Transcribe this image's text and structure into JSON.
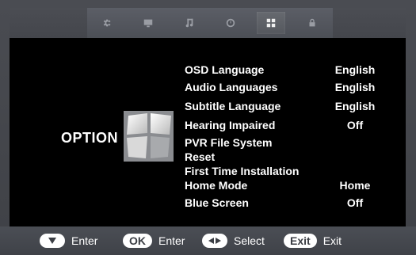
{
  "tabs": [
    {
      "icon": "gear-icon",
      "active": false
    },
    {
      "icon": "monitor-icon",
      "active": false
    },
    {
      "icon": "music-note-icon",
      "active": false
    },
    {
      "icon": "clock-icon",
      "active": false
    },
    {
      "icon": "grid-icon",
      "active": true
    },
    {
      "icon": "lock-icon",
      "active": false
    }
  ],
  "section": {
    "title": "OPTION"
  },
  "menu": {
    "items": [
      {
        "label": "OSD Language",
        "value": "English"
      },
      {
        "label": "Audio Languages",
        "value": "English"
      },
      {
        "label": "Subtitle Language",
        "value": "English"
      },
      {
        "label": "Hearing Impaired",
        "value": "Off"
      },
      {
        "label": "PVR File System",
        "value": ""
      },
      {
        "label": "Reset",
        "value": ""
      },
      {
        "label": "First Time Installation",
        "value": ""
      },
      {
        "label": "Home Mode",
        "value": "Home"
      },
      {
        "label": "Blue Screen",
        "value": "Off"
      }
    ]
  },
  "footer": {
    "hints": [
      {
        "key_icon": "down-triangle-icon",
        "key_text": "",
        "action": "Enter"
      },
      {
        "key_icon": "",
        "key_text": "OK",
        "action": "Enter"
      },
      {
        "key_icon": "left-right-arrows-icon",
        "key_text": "",
        "action": "Select"
      },
      {
        "key_icon": "",
        "key_text": "Exit",
        "action": "Exit"
      }
    ]
  }
}
